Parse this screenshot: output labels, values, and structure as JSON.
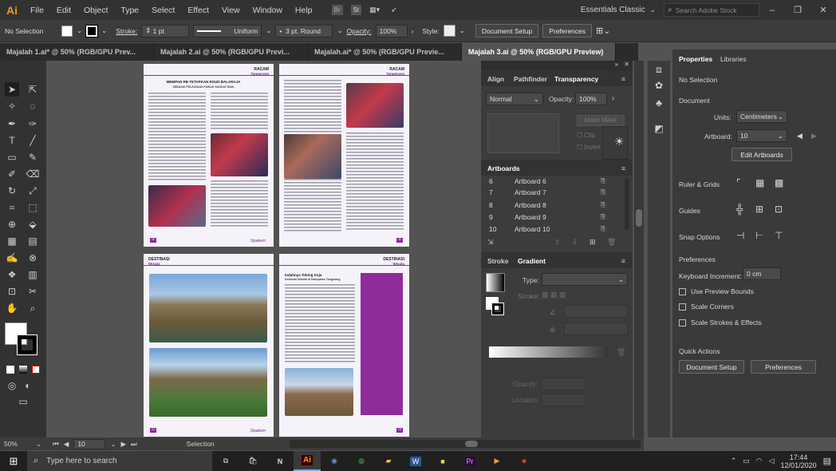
{
  "app": {
    "logo": "Ai",
    "workspace": "Essentials Classic",
    "search_placeholder": "Search Adobe Stock",
    "bridge": "Br",
    "stock": "St"
  },
  "menu": [
    "File",
    "Edit",
    "Object",
    "Type",
    "Select",
    "Effect",
    "View",
    "Window",
    "Help"
  ],
  "control": {
    "selection": "No Selection",
    "stroke_label": "Stroke:",
    "stroke_value": "1 pt",
    "uniform": "Uniform",
    "brush": "3 pt. Round",
    "opacity_label": "Opacity:",
    "opacity_value": "100%",
    "style_label": "Style:",
    "doc_setup": "Document Setup",
    "preferences": "Preferences"
  },
  "tabs": [
    "Majalah 1.ai* @ 50% (RGB/GPU Prev...",
    "Majalah 2.ai @ 50% (RGB/GPU Previ...",
    "Majalah.ai* @ 50% (RGB/GPU Previe...",
    "Majalah 3.ai @ 50% (RGB/GPU Preview)"
  ],
  "pages": {
    "p1": {
      "hdr": "RACAM",
      "sub": "Tangerang",
      "title": "MEMPAN RB TETAPKAN RSUD BALARAJA",
      "subtitle": "SEBAGAI PELAYANAN PUBLIK SANGAT BAIK",
      "num": "10"
    },
    "p2": {
      "hdr": "RACAM",
      "sub": "Tangerang",
      "num": "11"
    },
    "p3": {
      "hdr": "DESTINASI",
      "sub": "Wisata",
      "num": "12"
    },
    "p4": {
      "hdr": "DESTINASI",
      "sub": "Wisata",
      "title": "Indahnya Tebing Koja",
      "subtitle": "Destinasi Wisata di Kabupaten Tangerang",
      "num": "13"
    },
    "footer": "Sipakem"
  },
  "transparency": {
    "tabs": [
      "Align",
      "Pathfinder",
      "Transparency"
    ],
    "mode": "Normal",
    "opacity_label": "Opacity:",
    "opacity_value": "100%",
    "make_mask": "Make Mask",
    "clip": "Clip",
    "invert": "Invert"
  },
  "artboards": {
    "title": "Artboards",
    "rows": [
      {
        "n": "6",
        "name": "Artboard 6"
      },
      {
        "n": "7",
        "name": "Artboard 7"
      },
      {
        "n": "8",
        "name": "Artboard 8"
      },
      {
        "n": "9",
        "name": "Artboard 9"
      },
      {
        "n": "10",
        "name": "Artboard 10"
      }
    ]
  },
  "gradient": {
    "tabs": [
      "Stroke",
      "Gradient"
    ],
    "type_label": "Type:",
    "stroke_label": "Stroke:",
    "opacity_label": "Opacity:",
    "location_label": "Location:"
  },
  "properties": {
    "tabs": [
      "Properties",
      "Libraries"
    ],
    "no_selection": "No Selection",
    "document": "Document",
    "units_label": "Units:",
    "units_value": "Centimeters",
    "artboard_label": "Artboard:",
    "artboard_value": "10",
    "edit_artboards": "Edit Artboards",
    "ruler_grids": "Ruler & Grids",
    "guides": "Guides",
    "snap_options": "Snap Options",
    "preferences": "Preferences",
    "kbd_label": "Keyboard Increment:",
    "kbd_value": "0 cm",
    "use_preview": "Use Preview Bounds",
    "scale_corners": "Scale Corners",
    "scale_strokes": "Scale Strokes & Effects",
    "quick_actions": "Quick Actions",
    "doc_setup": "Document Setup",
    "prefs_btn": "Preferences"
  },
  "status": {
    "zoom": "50%",
    "artboard": "10",
    "tool": "Selection"
  },
  "taskbar": {
    "search": "Type here to search",
    "time": "17:44",
    "date": "12/01/2020",
    "ai": "Ai"
  }
}
